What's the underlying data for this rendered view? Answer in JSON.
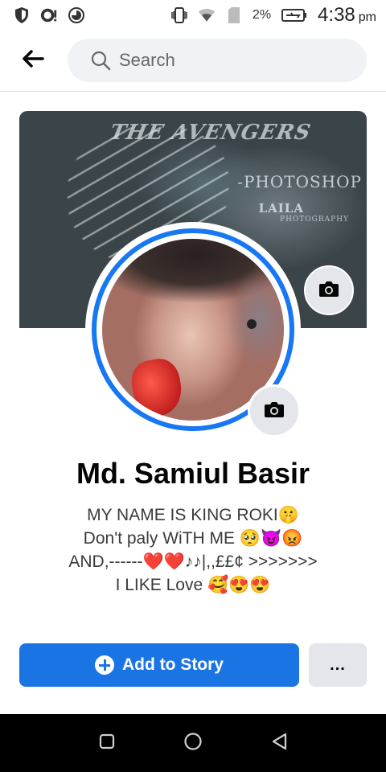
{
  "status_bar": {
    "battery_percent": "2%",
    "time": "4:38",
    "ampm": "pm",
    "icons": [
      "shield-icon",
      "notification-icon",
      "data-saver-icon",
      "vibrate-icon",
      "wifi-icon",
      "sim-icon",
      "battery-charging-icon"
    ]
  },
  "header": {
    "back_icon": "arrow-left-icon",
    "search_placeholder": "Search"
  },
  "cover": {
    "overlay_texts": [
      "THE AVENGERS",
      "-PHOTOSHOP",
      "LAILA",
      "PHOTOGRAPHY"
    ],
    "camera_icon": "camera-icon"
  },
  "profile": {
    "name": "Md. Samiul Basir",
    "bio_lines": [
      "MY NAME IS KING ROKI🤫",
      "Don't paly WiTH ME 🥺😈😡",
      "AND,------❤️❤️♪♪|,,££¢ >>>>>>>",
      "I LIKE Love 🥰😍😍"
    ],
    "picture_camera_icon": "camera-icon"
  },
  "actions": {
    "add_story_label": "Add to Story",
    "more_label": "..."
  },
  "nav": {
    "buttons": [
      "recents-square-icon",
      "home-circle-icon",
      "back-triangle-icon"
    ]
  },
  "colors": {
    "accent": "#1877f2",
    "button_blue": "#1b74e4",
    "button_grey": "#e4e6eb",
    "search_bg": "#f0f2f5",
    "nav_bg": "#000000"
  }
}
